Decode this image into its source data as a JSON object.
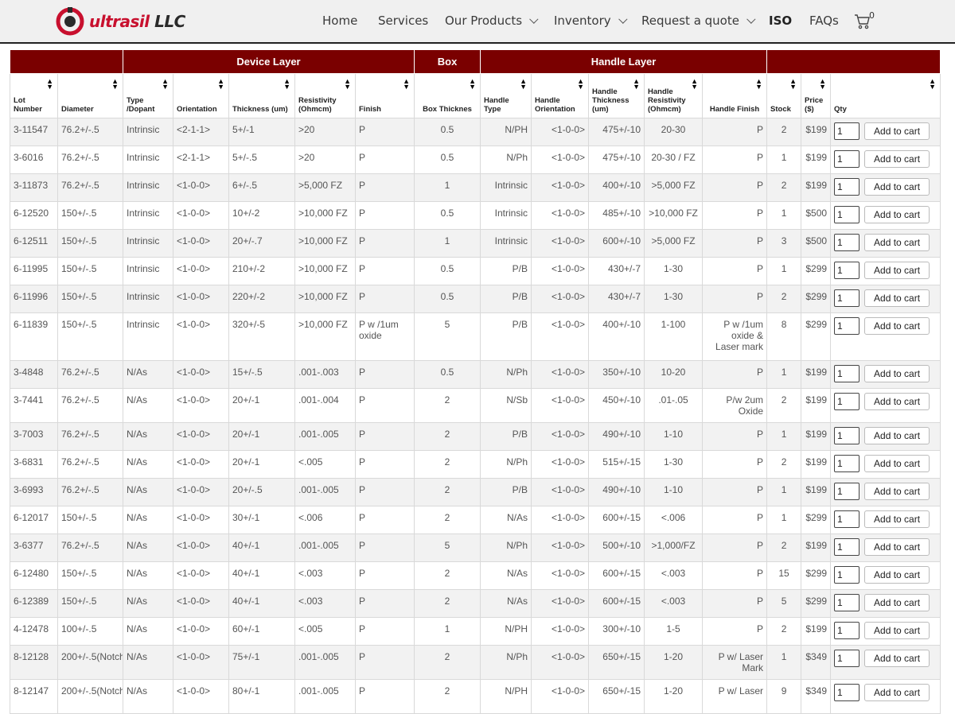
{
  "brand": {
    "name_prefix": "ultrasil",
    "name_suffix": " LLC"
  },
  "nav": {
    "home": "Home",
    "services": "Services",
    "products": "Our Products",
    "inventory": "Inventory",
    "quote": "Request a quote",
    "iso": "ISO",
    "faqs": "FAQs",
    "cart_count": "0"
  },
  "groups": {
    "device": "Device Layer",
    "box": "Box",
    "handle": "Handle Layer"
  },
  "columns": {
    "lot": "Lot Number",
    "diameter": "Diameter",
    "type": "Type /Dopant",
    "orientation": "Orientation",
    "thickness": "Thickness (um)",
    "resistivity": "Resistivity (Ohmcm)",
    "finish": "Finish",
    "box_thickness": "Box Thicknes",
    "h_type": "Handle Type",
    "h_orientation": "Handle Orientation",
    "h_thickness": "Handle Thickness (um)",
    "h_resistivity": "Handle Resistivity (Ohmcm)",
    "h_finish": "Handle Finish",
    "stock": "Stock",
    "price": "Price ($)",
    "qty": "Qty"
  },
  "add_to_cart_label": "Add to cart",
  "rows": [
    [
      "3-11547",
      "76.2+/-.5",
      "Intrinsic",
      "<2-1-1>",
      "5+/-1",
      ">20",
      "P",
      "0.5",
      "N/PH",
      "<1-0-0>",
      "475+/-10",
      "20-30",
      "P",
      "2",
      "$199",
      "1"
    ],
    [
      "3-6016",
      "76.2+/-.5",
      "Intrinsic",
      "<2-1-1>",
      "5+/-.5",
      ">20",
      "P",
      "0.5",
      "N/Ph",
      "<1-0-0>",
      "475+/-10",
      "20-30 / FZ",
      "P",
      "1",
      "$199",
      "1"
    ],
    [
      "3-11873",
      "76.2+/-.5",
      "Intrinsic",
      "<1-0-0>",
      "6+/-.5",
      ">5,000 FZ",
      "P",
      "1",
      "Intrinsic",
      "<1-0-0>",
      "400+/-10",
      ">5,000 FZ",
      "P",
      "2",
      "$199",
      "1"
    ],
    [
      "6-12520",
      "150+/-.5",
      "Intrinsic",
      "<1-0-0>",
      "10+/-2",
      ">10,000 FZ",
      "P",
      "0.5",
      "Intrinsic",
      "<1-0-0>",
      "485+/-10",
      ">10,000 FZ",
      "P",
      "1",
      "$500",
      "1"
    ],
    [
      "6-12511",
      "150+/-.5",
      "Intrinsic",
      "<1-0-0>",
      "20+/-.7",
      ">10,000 FZ",
      "P",
      "1",
      "Intrinsic",
      "<1-0-0>",
      "600+/-10",
      ">5,000 FZ",
      "P",
      "3",
      "$500",
      "1"
    ],
    [
      "6-11995",
      "150+/-.5",
      "Intrinsic",
      "<1-0-0>",
      "210+/-2",
      ">10,000 FZ",
      "P",
      "0.5",
      "P/B",
      "<1-0-0>",
      "430+/-7",
      "1-30",
      "P",
      "1",
      "$299",
      "1"
    ],
    [
      "6-11996",
      "150+/-.5",
      "Intrinsic",
      "<1-0-0>",
      "220+/-2",
      ">10,000 FZ",
      "P",
      "0.5",
      "P/B",
      "<1-0-0>",
      "430+/-7",
      "1-30",
      "P",
      "2",
      "$299",
      "1"
    ],
    [
      "6-11839",
      "150+/-.5",
      "Intrinsic",
      "<1-0-0>",
      "320+/-5",
      ">10,000 FZ",
      "P w /1um oxide",
      "5",
      "P/B",
      "<1-0-0>",
      "400+/-10",
      "1-100",
      "P w /1um oxide & Laser mark",
      "8",
      "$299",
      "1"
    ],
    [
      "3-4848",
      "76.2+/-.5",
      "N/As",
      "<1-0-0>",
      "15+/-.5",
      ".001-.003",
      "P",
      "0.5",
      "N/Ph",
      "<1-0-0>",
      "350+/-10",
      "10-20",
      "P",
      "1",
      "$199",
      "1"
    ],
    [
      "3-7441",
      "76.2+/-.5",
      "N/As",
      "<1-0-0>",
      "20+/-1",
      ".001-.004",
      "P",
      "2",
      "N/Sb",
      "<1-0-0>",
      "450+/-10",
      ".01-.05",
      "P/w 2um Oxide",
      "2",
      "$199",
      "1"
    ],
    [
      "3-7003",
      "76.2+/-.5",
      "N/As",
      "<1-0-0>",
      "20+/-1",
      ".001-.005",
      "P",
      "2",
      "P/B",
      "<1-0-0>",
      "490+/-10",
      "1-10",
      "P",
      "1",
      "$199",
      "1"
    ],
    [
      "3-6831",
      "76.2+/-.5",
      "N/As",
      "<1-0-0>",
      "20+/-1",
      "<.005",
      "P",
      "2",
      "N/Ph",
      "<1-0-0>",
      "515+/-15",
      "1-30",
      "P",
      "2",
      "$199",
      "1"
    ],
    [
      "3-6993",
      "76.2+/-.5",
      "N/As",
      "<1-0-0>",
      "20+/-.5",
      ".001-.005",
      "P",
      "2",
      "P/B",
      "<1-0-0>",
      "490+/-10",
      "1-10",
      "P",
      "1",
      "$199",
      "1"
    ],
    [
      "6-12017",
      "150+/-.5",
      "N/As",
      "<1-0-0>",
      "30+/-1",
      "<.006",
      "P",
      "2",
      "N/As",
      "<1-0-0>",
      "600+/-15",
      "<.006",
      "P",
      "1",
      "$299",
      "1"
    ],
    [
      "3-6377",
      "76.2+/-.5",
      "N/As",
      "<1-0-0>",
      "40+/-1",
      ".001-.005",
      "P",
      "5",
      "N/Ph",
      "<1-0-0>",
      "500+/-10",
      ">1,000/FZ",
      "P",
      "2",
      "$199",
      "1"
    ],
    [
      "6-12480",
      "150+/-.5",
      "N/As",
      "<1-0-0>",
      "40+/-1",
      "<.003",
      "P",
      "2",
      "N/As",
      "<1-0-0>",
      "600+/-15",
      "<.003",
      "P",
      "15",
      "$299",
      "1"
    ],
    [
      "6-12389",
      "150+/-.5",
      "N/As",
      "<1-0-0>",
      "40+/-1",
      "<.003",
      "P",
      "2",
      "N/As",
      "<1-0-0>",
      "600+/-15",
      "<.003",
      "P",
      "5",
      "$299",
      "1"
    ],
    [
      "4-12478",
      "100+/-.5",
      "N/As",
      "<1-0-0>",
      "60+/-1",
      "<.005",
      "P",
      "1",
      "N/PH",
      "<1-0-0>",
      "300+/-10",
      "1-5",
      "P",
      "2",
      "$199",
      "1"
    ],
    [
      "8-12128",
      "200+/-.5(Notch)",
      "N/As",
      "<1-0-0>",
      "75+/-1",
      ".001-.005",
      "P",
      "2",
      "N/Ph",
      "<1-0-0>",
      "650+/-15",
      "1-20",
      "P w/ Laser Mark",
      "1",
      "$349",
      "1"
    ],
    [
      "8-12147",
      "200+/-.5(Notch)",
      "N/As",
      "<1-0-0>",
      "80+/-1",
      ".001-.005",
      "P",
      "2",
      "N/PH",
      "<1-0-0>",
      "650+/-15",
      "1-20",
      "P w/ Laser",
      "9",
      "$349",
      "1"
    ]
  ]
}
